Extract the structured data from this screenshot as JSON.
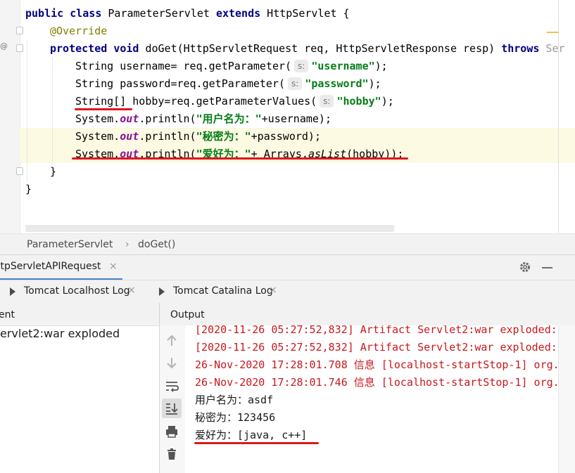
{
  "editor": {
    "lines": {
      "l1": {
        "kw1": "public",
        "kw2": "class",
        "name": " ParameterServlet ",
        "kw3": "extends",
        "rest": " HttpServlet {"
      },
      "l2": {
        "ann": "@Override"
      },
      "l3": {
        "kw1": "protected",
        "kw2": "void",
        "rest": " doGet(HttpServletRequest req, HttpServletResponse resp) ",
        "kw3": "throws",
        "tail": " Ser"
      },
      "l4": {
        "pre": "String username= req.getParameter(",
        "hint": "s:",
        "str": "\"username\"",
        "post": ");"
      },
      "l5": {
        "pre": "String password=req.getParameter(",
        "hint": "s:",
        "str": "\"password\"",
        "post": ");"
      },
      "l6": {
        "pre": "String[] hobby=req.getParameterValues(",
        "hint": "s:",
        "str": "\"hobby\"",
        "post": ");"
      },
      "l7": {
        "pre": "System.",
        "stat": "out",
        "mid": ".println(",
        "str": "\"用户名为：\"",
        "post": "+username);"
      },
      "l8": {
        "pre": "System.",
        "stat": "out",
        "mid": ".println(",
        "str": "\"秘密为：\"",
        "post": "+password);"
      },
      "l9": {
        "pre": "System.",
        "stat": "out",
        "mid": ".println(",
        "str": "\"爱好为：\"",
        "post": "+ Arrays.",
        "meth": "asList",
        "tail": "(hobby));"
      },
      "l10": {
        "text": "}"
      },
      "l11": {
        "text": "}"
      }
    }
  },
  "breadcrumb": {
    "class_name": "ParameterServlet",
    "sep": "›",
    "method": "doGet()"
  },
  "run_window": {
    "tab_label": "ttpServletAPIRequest",
    "close": "×",
    "subtabs": [
      {
        "label": "Tomcat Localhost Log",
        "close": "×"
      },
      {
        "label": "Tomcat Catalina Log",
        "close": "×"
      }
    ],
    "left_header": "ent",
    "left_row": "ervlet2:war exploded",
    "output_header": "Output",
    "output_lines": [
      "[2020-11-26 05:27:52,832] Artifact Servlet2:war exploded: ",
      "[2020-11-26 05:27:52,832] Artifact Servlet2:war exploded: ",
      "26-Nov-2020 17:28:01.708 信息 [localhost-startStop-1] org.",
      "26-Nov-2020 17:28:01.746 信息 [localhost-startStop-1] org.",
      "用户名为：asdf",
      "秘密为：123456",
      "爱好为：[java, c++]"
    ]
  },
  "colors": {
    "accent": "#4083c9",
    "annotation_red": "#e0161e",
    "string_green": "#067d17",
    "keyword_blue": "#000080",
    "log_red": "#c8181c"
  }
}
